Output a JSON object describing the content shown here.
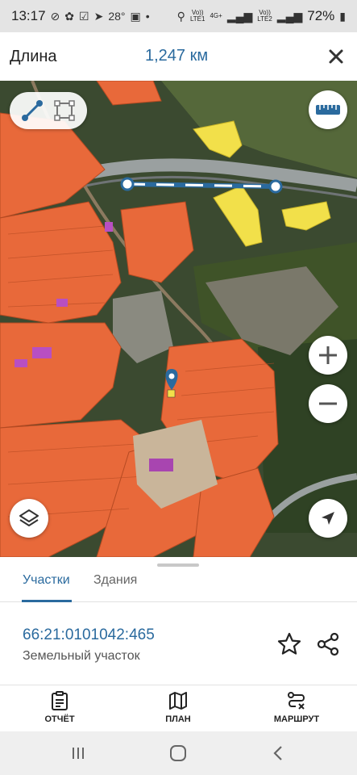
{
  "status_bar": {
    "time": "13:17",
    "temperature": "28°",
    "network1": "Vo))\nLTE1",
    "network2": "Vo))\nLTE2",
    "network_type": "4G+",
    "battery": "72%"
  },
  "header": {
    "title": "Длина",
    "measured_length": "1,247 км",
    "close_icon": "close-icon"
  },
  "map": {
    "buttons": {
      "line_tool": "line-measure-icon",
      "area_tool": "area-measure-icon",
      "ruler": "ruler-icon",
      "zoom_in": "plus-icon",
      "zoom_out": "minus-icon",
      "layers": "layers-icon",
      "locate": "navigation-arrow-icon"
    },
    "colors": {
      "parcel_fill": "#e8693a",
      "parcel_highlight": "#f2e04a",
      "measure_line": "#2a6a9e",
      "marker": "#2a6a9e"
    }
  },
  "panel": {
    "tabs": [
      {
        "label": "Участки",
        "active": true
      },
      {
        "label": "Здания",
        "active": false
      }
    ],
    "parcel_number": "66:21:0101042:465",
    "parcel_type": "Земельный участок",
    "star_icon": "star-icon",
    "share_icon": "share-icon"
  },
  "actions": [
    {
      "label": "ОТЧЁТ",
      "icon": "report-icon"
    },
    {
      "label": "ПЛАН",
      "icon": "map-plan-icon"
    },
    {
      "label": "МАРШРУТ",
      "icon": "route-icon"
    }
  ],
  "system_nav": [
    "recents-icon",
    "home-icon",
    "back-icon"
  ]
}
